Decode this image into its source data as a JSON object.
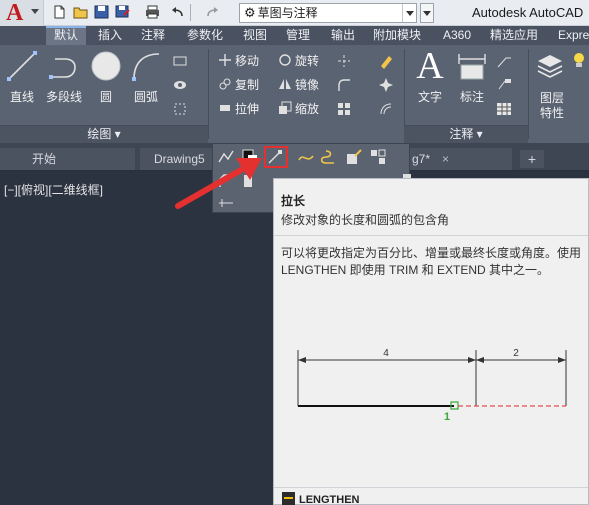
{
  "app": {
    "title": "Autodesk AutoCAD",
    "logo_letter": "A"
  },
  "quick_access": {
    "workspace": "草图与注释",
    "icons": [
      "new-icon",
      "open-icon",
      "save-icon",
      "save-as-icon",
      "print-icon",
      "undo-icon",
      "redo-icon"
    ]
  },
  "ribbon_tabs": [
    "默认",
    "插入",
    "注释",
    "参数化",
    "视图",
    "管理",
    "输出",
    "附加模块",
    "A360",
    "精选应用",
    "Expre"
  ],
  "active_tab": "默认",
  "draw_panel": {
    "tools": [
      "直线",
      "多段线",
      "圆",
      "圆弧"
    ],
    "footer": "绘图 ▾"
  },
  "modify_panel": {
    "rows": [
      [
        "移动",
        "旋转"
      ],
      [
        "复制",
        "镜像"
      ],
      [
        "拉伸",
        "缩放"
      ]
    ]
  },
  "annotation_panel": {
    "tools": [
      "文字",
      "标注"
    ],
    "footer": "注释 ▾"
  },
  "layers_panel": {
    "label_line1": "图层",
    "label_line2": "特性"
  },
  "file_tabs": {
    "start": "开始",
    "drawing5": "Drawing5",
    "drawing7": "g7*",
    "close": "×",
    "plus": "+"
  },
  "viewport_label": "[−][俯视][二维线框]",
  "tooltip": {
    "title": "拉长",
    "description": "修改对象的长度和圆弧的包含角",
    "detail": "可以将更改指定为百分比、增量或最终长度或角度。使用 LENGTHEN 即使用 TRIM 和 EXTEND 其中之一。",
    "diagram_label_a": "4",
    "diagram_label_b": "2",
    "diagram_point": "1",
    "command": "LENGTHEN"
  },
  "colors": {
    "ribbon_bg": "#5a6372",
    "drawing_bg": "#2b3240",
    "highlight": "#e53030",
    "pick_green": "#3aa83a"
  }
}
